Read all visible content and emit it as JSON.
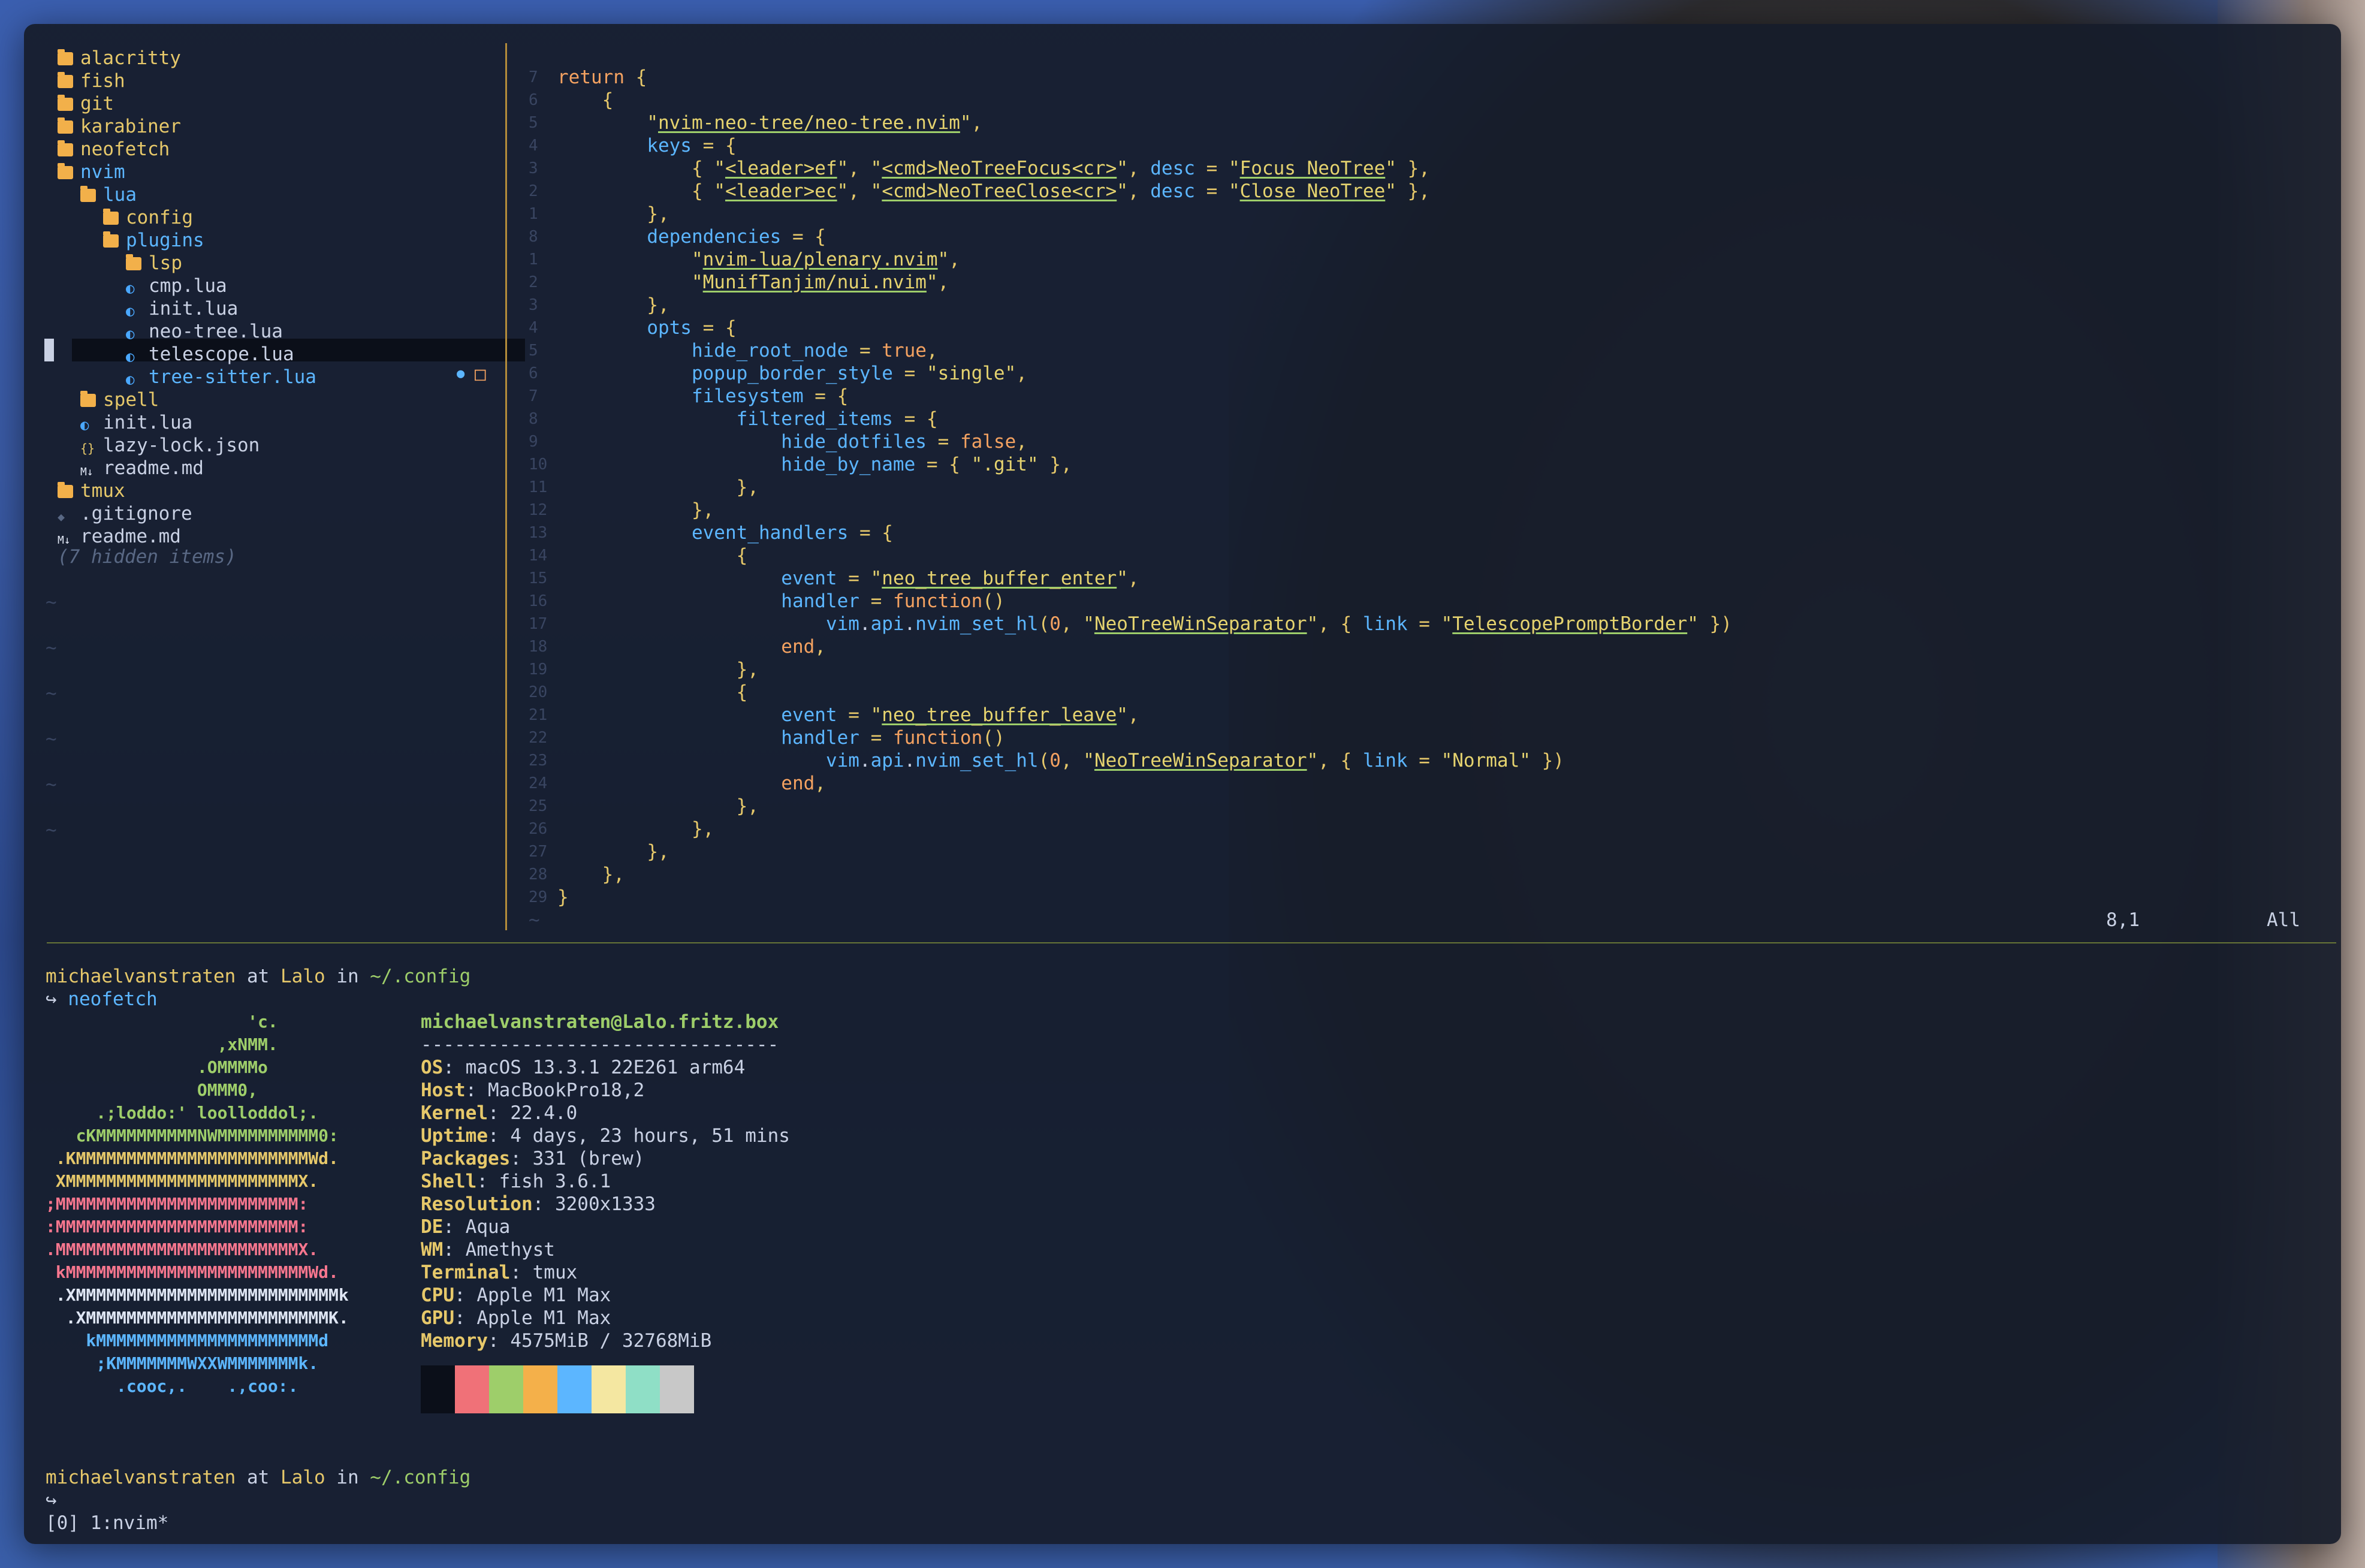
{
  "tree": {
    "items": [
      {
        "label": "alacritty",
        "kind": "folder",
        "depth": 0
      },
      {
        "label": "fish",
        "kind": "folder",
        "depth": 0
      },
      {
        "label": "git",
        "kind": "folder",
        "depth": 0
      },
      {
        "label": "karabiner",
        "kind": "folder",
        "depth": 0
      },
      {
        "label": "neofetch",
        "kind": "folder",
        "depth": 0
      },
      {
        "label": "nvim",
        "kind": "folder-open",
        "depth": 0
      },
      {
        "label": "lua",
        "kind": "folder-open",
        "depth": 1
      },
      {
        "label": "config",
        "kind": "folder",
        "depth": 2
      },
      {
        "label": "plugins",
        "kind": "folder-open",
        "depth": 2
      },
      {
        "label": "lsp",
        "kind": "folder",
        "depth": 3
      },
      {
        "label": "cmp.lua",
        "kind": "lua",
        "depth": 3
      },
      {
        "label": "init.lua",
        "kind": "lua",
        "depth": 3
      },
      {
        "label": "neo-tree.lua",
        "kind": "lua",
        "depth": 3
      },
      {
        "label": "telescope.lua",
        "kind": "lua",
        "depth": 3
      },
      {
        "label": "tree-sitter.lua",
        "kind": "lua",
        "depth": 3
      },
      {
        "label": "spell",
        "kind": "folder",
        "depth": 1
      },
      {
        "label": "init.lua",
        "kind": "lua",
        "depth": 1
      },
      {
        "label": "lazy-lock.json",
        "kind": "json",
        "depth": 1
      },
      {
        "label": "readme.md",
        "kind": "md",
        "depth": 1
      },
      {
        "label": "tmux",
        "kind": "folder",
        "depth": 0
      },
      {
        "label": ".gitignore",
        "kind": "git",
        "depth": 0
      },
      {
        "label": "readme.md",
        "kind": "md",
        "depth": 0
      }
    ],
    "hidden_note": "(7 hidden items)",
    "modified_marker": "●",
    "untracked_marker": "□"
  },
  "editor": {
    "gutter": [
      "7",
      "6",
      "5",
      "4",
      "3",
      "2",
      "1",
      "8",
      "1",
      "2",
      "3",
      "4",
      "5",
      "6",
      "7",
      "8",
      "9",
      "10",
      "11",
      "12",
      "13",
      "14",
      "15",
      "16",
      "17",
      "18",
      "19",
      "20",
      "21",
      "22",
      "23",
      "24",
      "25",
      "26",
      "27",
      "28",
      "29"
    ],
    "lines": [
      "return {",
      "    {",
      "        \"nvim-neo-tree/neo-tree.nvim\",",
      "        keys = {",
      "            { \"<leader>ef\", \"<cmd>NeoTreeFocus<cr>\", desc = \"Focus NeoTree\" },",
      "            { \"<leader>ec\", \"<cmd>NeoTreeClose<cr>\", desc = \"Close NeoTree\" },",
      "        },",
      "        dependencies = {",
      "            \"nvim-lua/plenary.nvim\",",
      "            \"MunifTanjim/nui.nvim\",",
      "        },",
      "        opts = {",
      "            hide_root_node = true,",
      "            popup_border_style = \"single\",",
      "            filesystem = {",
      "                filtered_items = {",
      "                    hide_dotfiles = false,",
      "                    hide_by_name = { \".git\" },",
      "                },",
      "            },",
      "            event_handlers = {",
      "                {",
      "                    event = \"neo_tree_buffer_enter\",",
      "                    handler = function()",
      "                        vim.api.nvim_set_hl(0, \"NeoTreeWinSeparator\", { link = \"TelescopePromptBorder\" })",
      "                    end,",
      "                },",
      "                {",
      "                    event = \"neo_tree_buffer_leave\",",
      "                    handler = function()",
      "                        vim.api.nvim_set_hl(0, \"NeoTreeWinSeparator\", { link = \"Normal\" })",
      "                    end,",
      "                },",
      "            },",
      "        },",
      "    },",
      "}"
    ],
    "status_pos": "8,1",
    "status_scroll": "All"
  },
  "shell": {
    "user": "michaelvanstraten",
    "at": "at",
    "host": "Lalo",
    "in": "in",
    "cwd": "~/.config",
    "arrow": "↪",
    "command": "neofetch"
  },
  "neofetch": {
    "header": "michaelvanstraten@Lalo.fritz.box",
    "rule": "--------------------------------",
    "fields": [
      {
        "key": "OS",
        "value": "macOS 13.3.1 22E261 arm64"
      },
      {
        "key": "Host",
        "value": "MacBookPro18,2"
      },
      {
        "key": "Kernel",
        "value": "22.4.0"
      },
      {
        "key": "Uptime",
        "value": "4 days, 23 hours, 51 mins"
      },
      {
        "key": "Packages",
        "value": "331 (brew)"
      },
      {
        "key": "Shell",
        "value": "fish 3.6.1"
      },
      {
        "key": "Resolution",
        "value": "3200x1333"
      },
      {
        "key": "DE",
        "value": "Aqua"
      },
      {
        "key": "WM",
        "value": "Amethyst"
      },
      {
        "key": "Terminal",
        "value": "tmux"
      },
      {
        "key": "CPU",
        "value": "Apple M1 Max"
      },
      {
        "key": "GPU",
        "value": "Apple M1 Max"
      },
      {
        "key": "Memory",
        "value": "4575MiB / 32768MiB"
      }
    ],
    "logo": [
      {
        "text": "                    'c.",
        "color": "#9ece6a"
      },
      {
        "text": "                 ,xNMM.",
        "color": "#9ece6a"
      },
      {
        "text": "               .OMMMMo",
        "color": "#9ece6a"
      },
      {
        "text": "               OMMM0,",
        "color": "#9ece6a"
      },
      {
        "text": "     .;loddo:' loolloddol;.",
        "color": "#9ece6a"
      },
      {
        "text": "   cKMMMMMMMMMMNWMMMMMMMMMM0:",
        "color": "#9ece6a"
      },
      {
        "text": " .KMMMMMMMMMMMMMMMMMMMMMMMWd.",
        "color": "#e6c86a"
      },
      {
        "text": " XMMMMMMMMMMMMMMMMMMMMMMMX.",
        "color": "#e6c86a"
      },
      {
        "text": ";MMMMMMMMMMMMMMMMMMMMMMMM:",
        "color": "#f7768e"
      },
      {
        "text": ":MMMMMMMMMMMMMMMMMMMMMMMM:",
        "color": "#f7768e"
      },
      {
        "text": ".MMMMMMMMMMMMMMMMMMMMMMMMX.",
        "color": "#f7768e"
      },
      {
        "text": " kMMMMMMMMMMMMMMMMMMMMMMMMWd.",
        "color": "#f7768e"
      },
      {
        "text": " .XMMMMMMMMMMMMMMMMMMMMMMMMMMk",
        "color": "#dfe6f4"
      },
      {
        "text": "  .XMMMMMMMMMMMMMMMMMMMMMMMMK.",
        "color": "#dfe6f4"
      },
      {
        "text": "    kMMMMMMMMMMMMMMMMMMMMMMd",
        "color": "#5cb6ff"
      },
      {
        "text": "     ;KMMMMMMMWXXWMMMMMMMk.",
        "color": "#5cb6ff"
      },
      {
        "text": "       .cooc,.    .,coo:.",
        "color": "#5cb6ff"
      }
    ],
    "palette": [
      "#0b0f19",
      "#f07178",
      "#9ece6a",
      "#f4b04a",
      "#5cb6ff",
      "#f4e7a1",
      "#8fdfc6",
      "#c8c8c8"
    ]
  },
  "tmux": {
    "status": "[0] 1:nvim*"
  }
}
